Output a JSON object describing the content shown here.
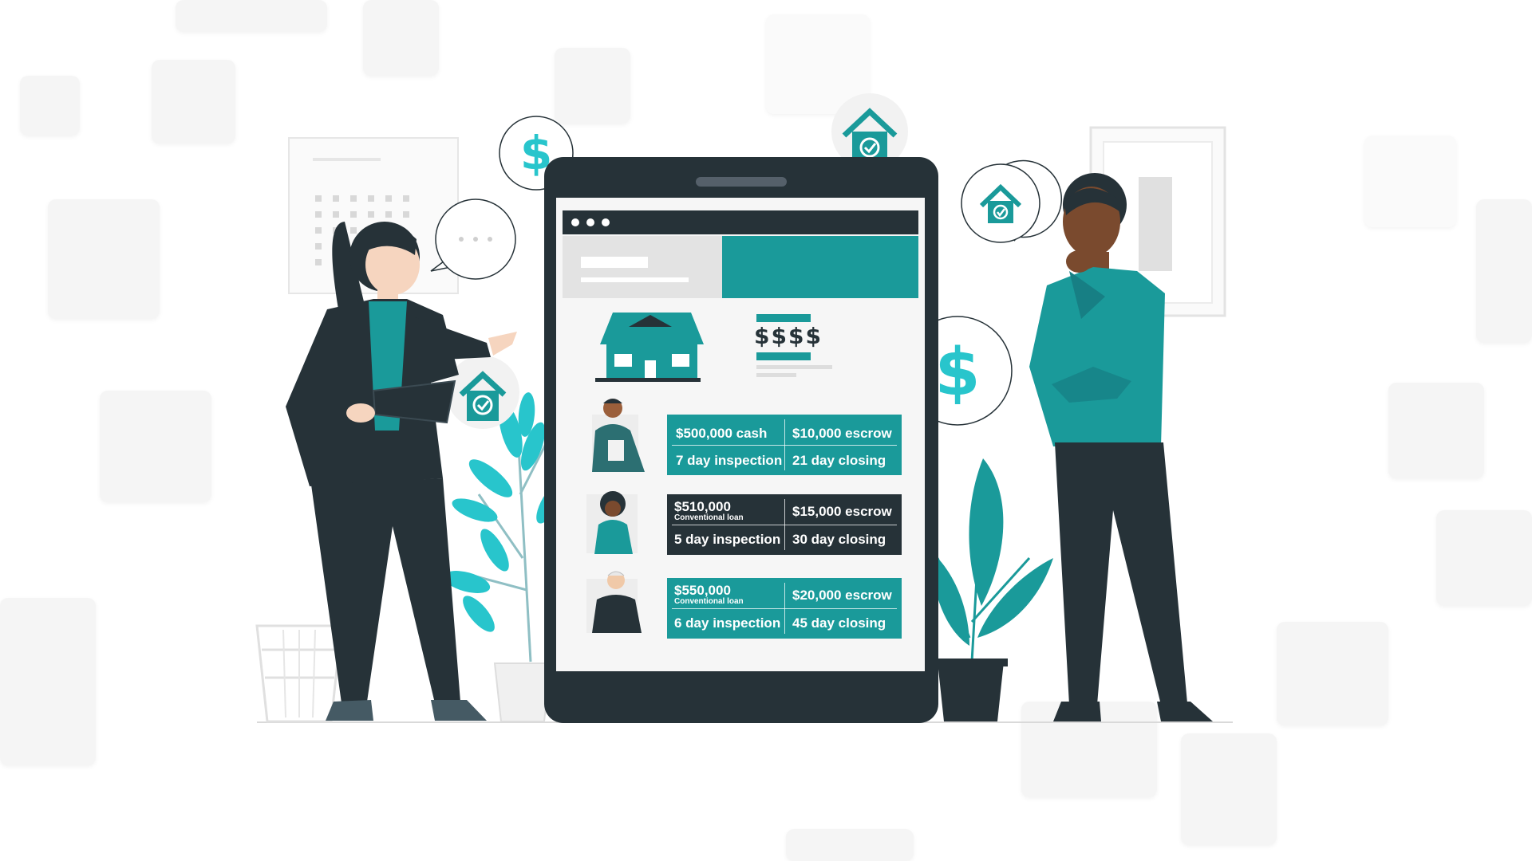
{
  "colors": {
    "accent": "#1a9a9a",
    "dark": "#263238",
    "screen_bg": "#f6f6f6",
    "cyan": "#28c5cc"
  },
  "icons": [
    "dollar-icon",
    "house-check-icon",
    "speech-bubble-icon"
  ],
  "phone": {
    "price_label": "$$$$"
  },
  "offers": [
    {
      "price": "$500,000 cash",
      "loan_type": "",
      "escrow": "$10,000 escrow",
      "inspection": "7 day inspection",
      "closing": "21 day closing",
      "style": "teal"
    },
    {
      "price": "$510,000",
      "loan_type": "Conventional loan",
      "escrow": "$15,000 escrow",
      "inspection": "5 day inspection",
      "closing": "30 day closing",
      "style": "dark"
    },
    {
      "price": "$550,000",
      "loan_type": "Conventional loan",
      "escrow": "$20,000 escrow",
      "inspection": "6 day inspection",
      "closing": "45 day closing",
      "style": "teal"
    }
  ]
}
